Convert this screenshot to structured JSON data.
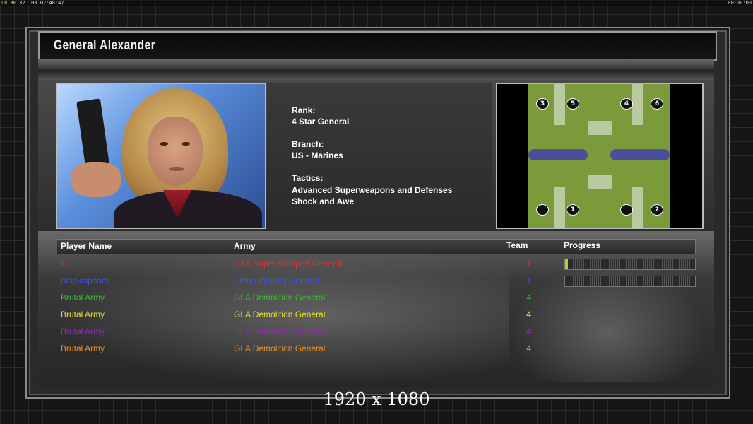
{
  "topbar": {
    "fps_label": "LR",
    "fps_values": "30 32",
    "fps_extra": "100",
    "clock_left": "02:48:47",
    "clock_right": "00:00:00"
  },
  "general": {
    "name": "General Alexander",
    "rank_label": "Rank:",
    "rank_value": "4 Star General",
    "branch_label": "Branch:",
    "branch_value": "US - Marines",
    "tactics_label": "Tactics:",
    "tactics_line1": "Advanced Superweapons and Defenses",
    "tactics_line2": "Shock and Awe"
  },
  "minimap": {
    "start_positions": [
      "3",
      "5",
      "4",
      "6",
      "1",
      "2"
    ]
  },
  "players_table": {
    "headers": {
      "name": "Player Name",
      "army": "Army",
      "team": "Team",
      "progress": "Progress"
    },
    "rows": [
      {
        "name": "lu",
        "army": "USA Super Weapon General",
        "team": "1",
        "color": "#e03030",
        "progress": 0.02,
        "show_bar": true
      },
      {
        "name": "magicspears",
        "army": "China Infantry General",
        "team": "1",
        "color": "#3c56e8",
        "progress": 0.0,
        "show_bar": true
      },
      {
        "name": "Brutal Army",
        "army": "GLA Demolition General",
        "team": "4",
        "color": "#2fc12f",
        "show_bar": false
      },
      {
        "name": "Brutal Army",
        "army": "GLA Demolition General",
        "team": "4",
        "color": "#e6df2e",
        "show_bar": false
      },
      {
        "name": "Brutal Army",
        "army": "GLA Demolition General",
        "team": "4",
        "color": "#9b22c9",
        "show_bar": false
      },
      {
        "name": "Brutal Army",
        "army": "GLA Demolition General",
        "team": "4",
        "color": "#e8902a",
        "show_bar": false
      }
    ]
  },
  "resolution_text": "1920 x 1080"
}
